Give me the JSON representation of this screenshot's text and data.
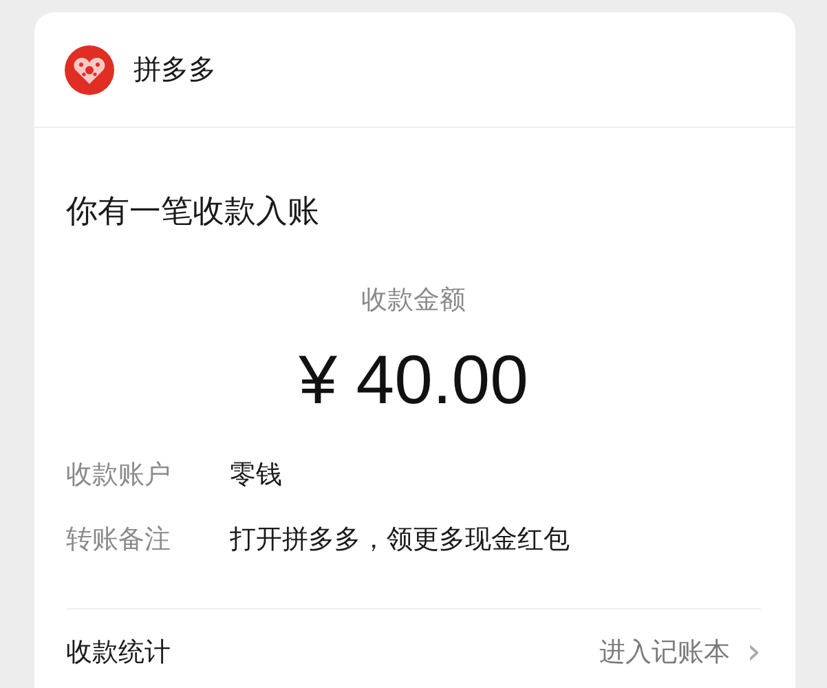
{
  "app": {
    "name": "拼多多"
  },
  "notice": {
    "title": "你有一笔收款入账",
    "amount_label": "收款金额",
    "amount": "¥ 40.00",
    "details": [
      {
        "label": "收款账户",
        "value": "零钱"
      },
      {
        "label": "转账备注",
        "value": "打开拼多多，领更多现金红包"
      }
    ]
  },
  "footer": {
    "label": "收款统计",
    "link": "进入记账本",
    "chevron": "›"
  }
}
